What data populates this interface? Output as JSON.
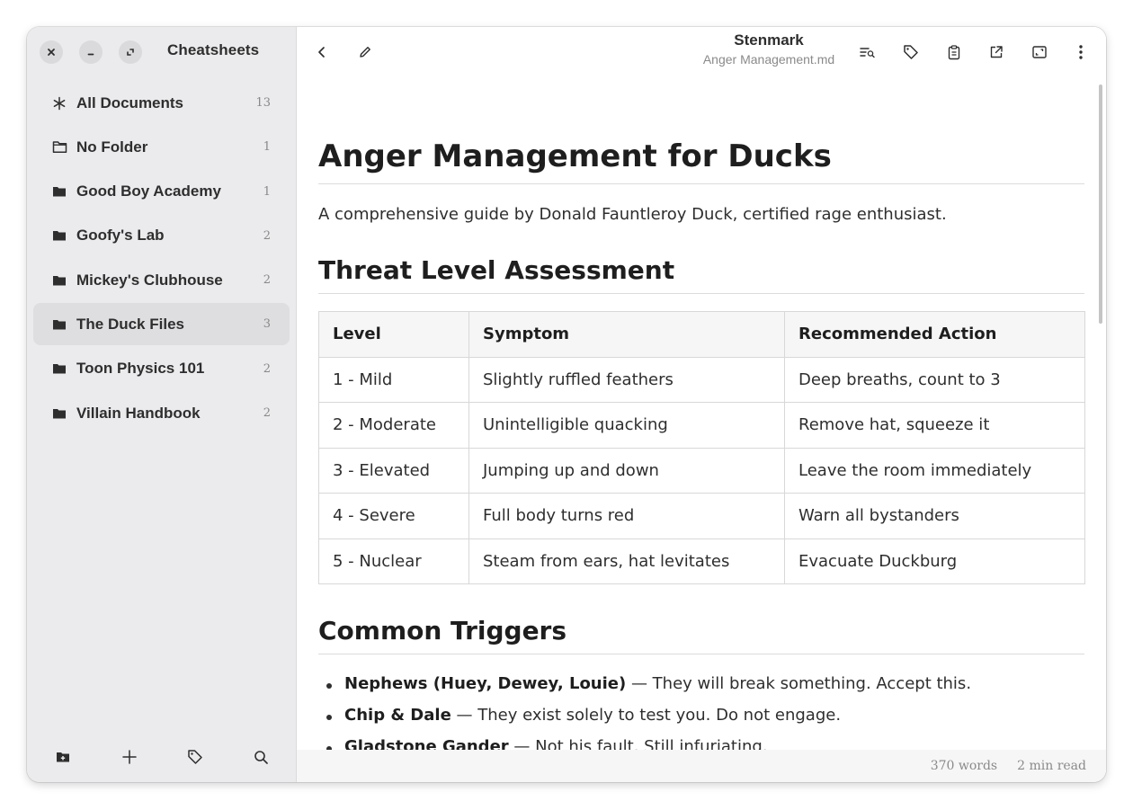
{
  "sidebar": {
    "title": "Cheatsheets",
    "items": [
      {
        "label": "All Documents",
        "count": "13",
        "icon": "asterisk-icon"
      },
      {
        "label": "No Folder",
        "count": "1",
        "icon": "folder-outline-icon"
      },
      {
        "label": "Good Boy Academy",
        "count": "1",
        "icon": "folder-icon"
      },
      {
        "label": "Goofy's Lab",
        "count": "2",
        "icon": "folder-icon"
      },
      {
        "label": "Mickey's Clubhouse",
        "count": "2",
        "icon": "folder-icon"
      },
      {
        "label": "The Duck Files",
        "count": "3",
        "icon": "folder-icon",
        "active": true
      },
      {
        "label": "Toon Physics 101",
        "count": "2",
        "icon": "folder-icon"
      },
      {
        "label": "Villain Handbook",
        "count": "2",
        "icon": "folder-icon"
      }
    ]
  },
  "header": {
    "app_name": "Stenmark",
    "file_name": "Anger Management.md"
  },
  "doc": {
    "title": "Anger Management for Ducks",
    "intro": "A comprehensive guide by Donald Fauntleroy Duck, certified rage enthusiast.",
    "section1": "Threat Level Assessment",
    "table": {
      "headers": [
        "Level",
        "Symptom",
        "Recommended Action"
      ],
      "rows": [
        [
          "1 - Mild",
          "Slightly ruffled feathers",
          "Deep breaths, count to 3"
        ],
        [
          "2 - Moderate",
          "Unintelligible quacking",
          "Remove hat, squeeze it"
        ],
        [
          "3 - Elevated",
          "Jumping up and down",
          "Leave the room immediately"
        ],
        [
          "4 - Severe",
          "Full body turns red",
          "Warn all bystanders"
        ],
        [
          "5 - Nuclear",
          "Steam from ears, hat levitates",
          "Evacuate Duckburg"
        ]
      ]
    },
    "section2": "Common Triggers",
    "triggers": [
      {
        "bold": "Nephews (Huey, Dewey, Louie)",
        "text": " — They will break something. Accept this."
      },
      {
        "bold": "Chip & Dale",
        "text": " — They exist solely to test you. Do not engage."
      },
      {
        "bold": "Gladstone Gander",
        "text": " — Not his fault. Still infuriating."
      }
    ]
  },
  "status": {
    "words": "370 words",
    "read_time": "2 min read"
  },
  "colors": {
    "sidebar_bg": "#ebebed",
    "active_item_bg": "#dedee0",
    "text": "#2e2e2e",
    "muted": "#8a8a8a"
  }
}
